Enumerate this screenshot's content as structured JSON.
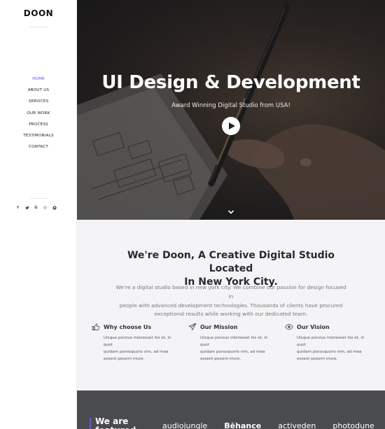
{
  "brand": {
    "logo": "DOON"
  },
  "nav": {
    "items": [
      {
        "label": "HOME",
        "active": true
      },
      {
        "label": "ABOUT US",
        "active": false
      },
      {
        "label": "SERVICES",
        "active": false
      },
      {
        "label": "OUR WORK",
        "active": false
      },
      {
        "label": "PROCESS",
        "active": false
      },
      {
        "label": "TESTIMONIALS",
        "active": false
      },
      {
        "label": "CONTACT",
        "active": false
      }
    ]
  },
  "social": {
    "icons": [
      {
        "name": "facebook-icon",
        "glyph": "f"
      },
      {
        "name": "twitter-icon",
        "glyph": "t"
      },
      {
        "name": "google-icon",
        "glyph": "G"
      },
      {
        "name": "dribbble-icon",
        "glyph": "◎"
      },
      {
        "name": "github-icon",
        "glyph": "●"
      }
    ]
  },
  "hero": {
    "title": "UI Design & Development",
    "subtitle": "Award Winning Digital Studio from USA!",
    "play_icon": "play-icon",
    "scroll_icon": "chevron-down-icon"
  },
  "about": {
    "title_line1": "We're Doon, A Creative Digital Studio Located",
    "title_line2": "In New York City.",
    "text_line1": "We're a digital studio based in new york city. We combine our passion for design focused in",
    "text_line2": "people with advanced development technologies. Thousands of clients have procured",
    "text_line3": "exceptional results while working with our dedicated team.",
    "features": [
      {
        "icon": "thumbs-up-icon",
        "title": "Why choose Us",
        "lines": [
          "Uisque porsius interesset his et, in quot",
          "quidam porsoquoris vim, ad mea",
          "essent possim iriure."
        ]
      },
      {
        "icon": "paper-plane-icon",
        "title": "Our Mission",
        "lines": [
          "Uisque porsius interesset his et, in quot",
          "quidam porsoquoris vim, ad mea",
          "essent possim iriure."
        ]
      },
      {
        "icon": "eye-icon",
        "title": "Our Vision",
        "lines": [
          "Uisque porsius interesset his et, in quot",
          "quidam porsoquoris vim, ad mea",
          "essent possim iriure."
        ]
      }
    ]
  },
  "partners": {
    "title_line1": "We are",
    "title_line2": "featured",
    "logos": [
      "audiojungle",
      "Bēhance",
      "activeden",
      "photodune"
    ]
  },
  "colors": {
    "accent": "#5a5be6",
    "band": "#4a4b4f",
    "section_bg": "#f4f4f6"
  }
}
